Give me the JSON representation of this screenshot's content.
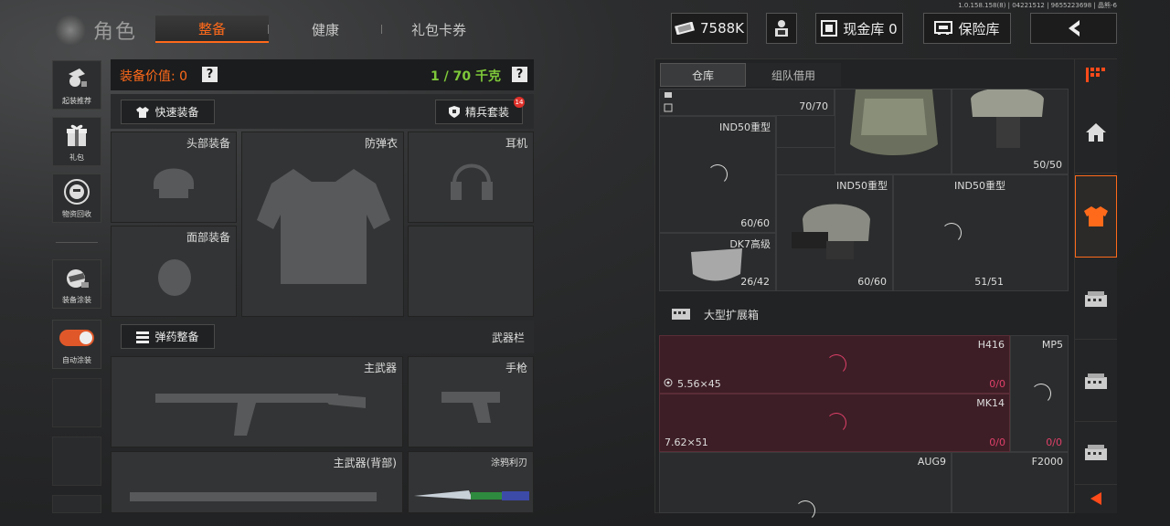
{
  "version": "1.0.158.158(8) | 04221512 | 9655223698 | 晶熊-6",
  "header": {
    "title": "角色",
    "tabs": [
      {
        "label": "整备",
        "active": true
      },
      {
        "label": "健康",
        "active": false
      },
      {
        "label": "礼包卡券",
        "active": false
      }
    ],
    "currency": "7588K",
    "cash_vault": "现金库 0",
    "safe_box": "保险库"
  },
  "left_menu": [
    {
      "label": "起装推荐",
      "icon": "recommend-icon"
    },
    {
      "label": "礼包",
      "icon": "gift-icon"
    },
    {
      "label": "物资回收",
      "icon": "recycle-icon"
    },
    {
      "label": "装备涂装",
      "icon": "paint-icon"
    },
    {
      "label": "自动涂装",
      "icon": "toggle-icon"
    }
  ],
  "equip": {
    "value_label": "装备价值: 0",
    "weight": "1 / 70 千克",
    "quick_equip": "快速装备",
    "elite_set": "精兵套装",
    "elite_badge": "14",
    "slots": {
      "head": "头部装备",
      "armor": "防弹衣",
      "ear": "耳机",
      "face": "面部装备"
    },
    "ammo_btn": "弹药整备",
    "weapon_bar": "武器栏",
    "weapons": {
      "primary": "主武器",
      "pistol": "手枪",
      "primary_back": "主武器(背部)",
      "melee": "涂鸦利刃"
    }
  },
  "inventory": {
    "tabs": [
      {
        "label": "仓库",
        "active": true
      },
      {
        "label": "组队借用",
        "active": false
      }
    ],
    "items": [
      {
        "name": "",
        "count": "70/70"
      },
      {
        "name": "IND50重型",
        "count": "60/60"
      },
      {
        "name": "",
        "count": "50/50"
      },
      {
        "name": "IND50重型",
        "count": "60/60"
      },
      {
        "name": "IND50重型",
        "count": "51/51"
      },
      {
        "name": "DK7高级",
        "count": "26/42"
      }
    ],
    "container_label": "大型扩展箱",
    "weapons": [
      {
        "name": "H416",
        "count": "0/0"
      },
      {
        "name": "MP5",
        "count": "0/0"
      },
      {
        "name": "MK14",
        "count": "0/0"
      },
      {
        "name": "AUG9",
        "count": ""
      },
      {
        "name": "F2000",
        "count": ""
      }
    ],
    "ammo": [
      "5.56×45",
      "7.62×51"
    ]
  },
  "colors": {
    "accent": "#ff6a1a",
    "weight_green": "#7ec93a",
    "count_pink": "#e0406a"
  }
}
